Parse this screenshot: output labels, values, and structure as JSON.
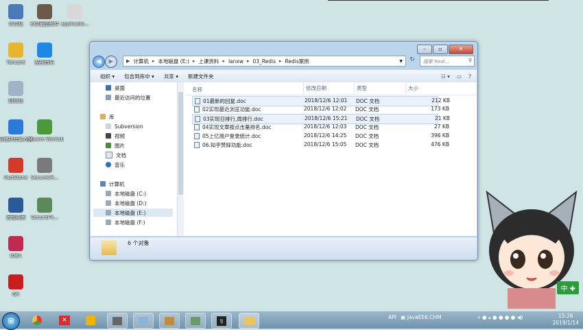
{
  "desktop": {
    "icons": [
      {
        "label": "计算机",
        "icon": "computer-icon",
        "color": "#4a78b8"
      },
      {
        "label": "幻灵截图软件",
        "icon": "person-icon",
        "color": "#6b5a4a"
      },
      {
        "label": "applicatio...",
        "icon": "file-icon",
        "color": "#d8d8d8"
      },
      {
        "label": "Tencent",
        "icon": "qq-icon",
        "color": "#e9b52e"
      },
      {
        "label": "酷狗音乐",
        "icon": "k-icon",
        "color": "#1e88e5"
      },
      {
        "label": "回收站",
        "icon": "recycle-bin-icon",
        "color": "#a0b4c8"
      },
      {
        "label": "百度拼音输入法",
        "icon": "g-icon",
        "color": "#2a7bd9"
      },
      {
        "label": "VMware Workstati...",
        "icon": "vmware-icon",
        "color": "#4a9a3a"
      },
      {
        "label": "FastStone",
        "icon": "faststone-icon",
        "color": "#d23a2a"
      },
      {
        "label": "SecureCR...",
        "icon": "securecrt-icon",
        "color": "#7a7a7a"
      },
      {
        "label": "远程桌面",
        "icon": "remote-icon",
        "color": "#2a5a9a"
      },
      {
        "label": "SecureFX...",
        "icon": "securefx-icon",
        "color": "#5a8a5a"
      },
      {
        "label": "IDEA",
        "icon": "idea-icon",
        "color": "#c22a52"
      },
      {
        "label": "GR",
        "icon": "gr-icon",
        "color": "#c81e1e"
      }
    ]
  },
  "window": {
    "address": [
      "计算机",
      "本地磁盘 (E:)",
      "上课资料",
      "lanxw",
      "03_Redis",
      "Redis案例"
    ],
    "search_placeholder": "搜索 Redi...",
    "toolbar": [
      "组织 ▾",
      "包含到库中 ▾",
      "共享 ▾",
      "新建文件夹"
    ],
    "nav": {
      "favorites": [
        "桌面",
        "最近访问的位置"
      ],
      "library_title": "库",
      "libraries": [
        "Subversion",
        "视频",
        "图片",
        "文档",
        "音乐"
      ],
      "computer_title": "计算机",
      "drives": [
        "本地磁盘 (C:)",
        "本地磁盘 (D:)",
        "本地磁盘 (E:)",
        "本地磁盘 (F:)"
      ]
    },
    "columns": {
      "name": "名称",
      "date": "修改日期",
      "type": "类型",
      "size": "大小"
    },
    "files": [
      {
        "name": "01最新的回复.doc",
        "date": "2018/12/6 12:01",
        "type": "DOC 文档",
        "size": "212 KB"
      },
      {
        "name": "02实现最近浏览功能.doc",
        "date": "2018/12/6 12:02",
        "type": "DOC 文档",
        "size": "173 KB"
      },
      {
        "name": "03实现日排行,周排行.doc",
        "date": "2018/12/6 15:21",
        "type": "DOC 文档",
        "size": "21 KB"
      },
      {
        "name": "04实现文章按点击量排名.doc",
        "date": "2018/12/6 12:03",
        "type": "DOC 文档",
        "size": "27 KB"
      },
      {
        "name": "05上亿用户登录统计.doc",
        "date": "2018/12/6 14:25",
        "type": "DOC 文档",
        "size": "396 KB"
      },
      {
        "name": "06.知乎赞踩功能.doc",
        "date": "2018/12/6 15:05",
        "type": "DOC 文档",
        "size": "476 KB"
      }
    ],
    "status": "6 个对象"
  },
  "taskbar": {
    "api_label": "API",
    "task": "JavaEE6.CHM",
    "time": "15:26",
    "date": "2019/1/14"
  },
  "mascot": {
    "badge": "中"
  }
}
